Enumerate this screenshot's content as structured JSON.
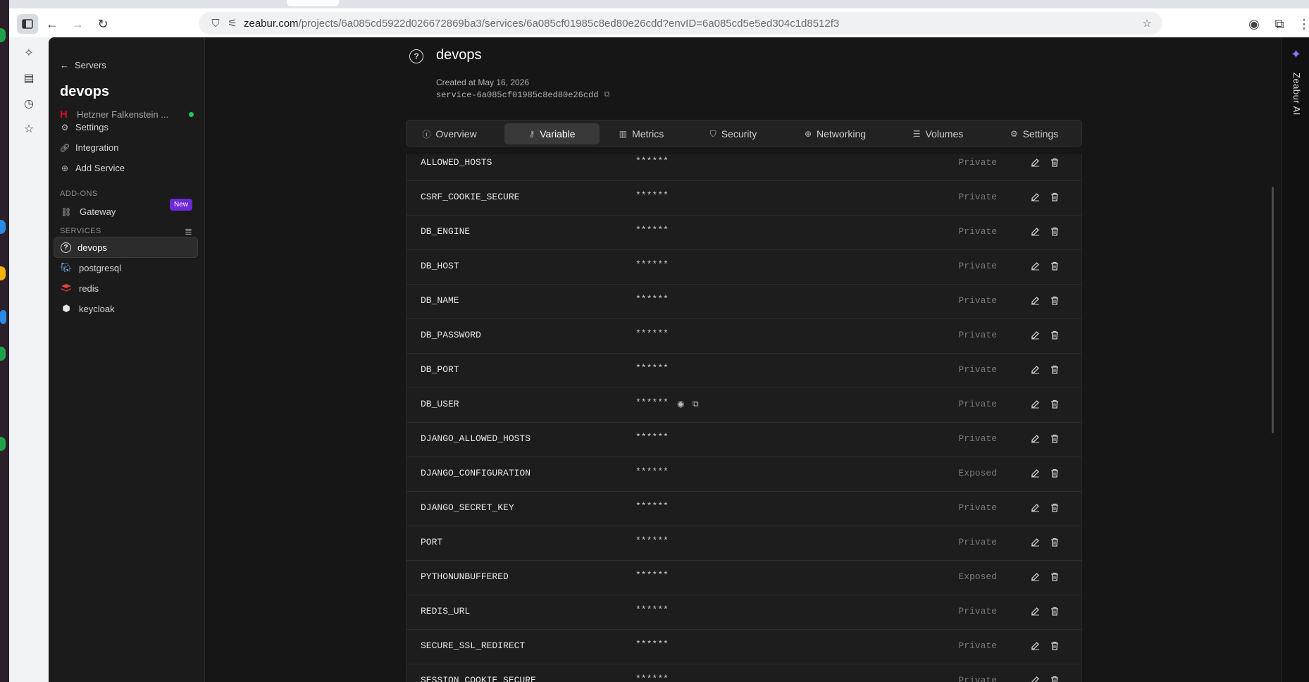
{
  "browser": {
    "url_host": "zeabur.com",
    "url_rest": "/projects/6a085cd5922d026672869ba3/services/6a085cf01985c8ed80e26cdd?envID=6a085cd5e5ed304c1d8512f3"
  },
  "sidebar": {
    "back_label": "Servers",
    "project_title": "devops",
    "server_name": "Hetzner Falkenstein ...",
    "nav": [
      {
        "label": "Settings",
        "icon": "gear-icon"
      },
      {
        "label": "Integration",
        "icon": "link-icon"
      },
      {
        "label": "Add Service",
        "icon": "plus-circle-icon"
      }
    ],
    "addons_title": "ADD-ONS",
    "gateway_label": "Gateway",
    "new_badge": "New",
    "services_title": "SERVICES",
    "services": [
      {
        "label": "devops",
        "icon": "help-circle-icon",
        "active": true
      },
      {
        "label": "postgresql",
        "icon": "postgresql-icon",
        "active": false
      },
      {
        "label": "redis",
        "icon": "redis-icon",
        "active": false
      },
      {
        "label": "keycloak",
        "icon": "keycloak-icon",
        "active": false
      }
    ]
  },
  "header": {
    "title": "devops",
    "created": "Created at May 16, 2026",
    "service_id": "service-6a085cf01985c8ed80e26cdd"
  },
  "tabs": [
    {
      "label": "Overview",
      "icon": "info-icon"
    },
    {
      "label": "Variable",
      "icon": "key-icon",
      "active": true
    },
    {
      "label": "Metrics",
      "icon": "bar-chart-icon"
    },
    {
      "label": "Security",
      "icon": "shield-icon"
    },
    {
      "label": "Networking",
      "icon": "globe-icon"
    },
    {
      "label": "Volumes",
      "icon": "database-icon"
    },
    {
      "label": "Settings",
      "icon": "gear-icon"
    }
  ],
  "variables": [
    {
      "key": "ALLOWED_HOSTS",
      "value": "******",
      "visibility": "Private"
    },
    {
      "key": "CSRF_COOKIE_SECURE",
      "value": "******",
      "visibility": "Private"
    },
    {
      "key": "DB_ENGINE",
      "value": "******",
      "visibility": "Private"
    },
    {
      "key": "DB_HOST",
      "value": "******",
      "visibility": "Private"
    },
    {
      "key": "DB_NAME",
      "value": "******",
      "visibility": "Private"
    },
    {
      "key": "DB_PASSWORD",
      "value": "******",
      "visibility": "Private"
    },
    {
      "key": "DB_PORT",
      "value": "******",
      "visibility": "Private"
    },
    {
      "key": "DB_USER",
      "value": "******",
      "visibility": "Private",
      "hovered": true
    },
    {
      "key": "DJANGO_ALLOWED_HOSTS",
      "value": "******",
      "visibility": "Private"
    },
    {
      "key": "DJANGO_CONFIGURATION",
      "value": "******",
      "visibility": "Exposed"
    },
    {
      "key": "DJANGO_SECRET_KEY",
      "value": "******",
      "visibility": "Private"
    },
    {
      "key": "PORT",
      "value": "******",
      "visibility": "Private"
    },
    {
      "key": "PYTHONUNBUFFERED",
      "value": "******",
      "visibility": "Exposed"
    },
    {
      "key": "REDIS_URL",
      "value": "******",
      "visibility": "Private"
    },
    {
      "key": "SECURE_SSL_REDIRECT",
      "value": "******",
      "visibility": "Private"
    },
    {
      "key": "SESSION_COOKIE_SECURE",
      "value": "******",
      "visibility": "Private"
    }
  ],
  "ai_panel": {
    "label": "Zeabur AI"
  }
}
